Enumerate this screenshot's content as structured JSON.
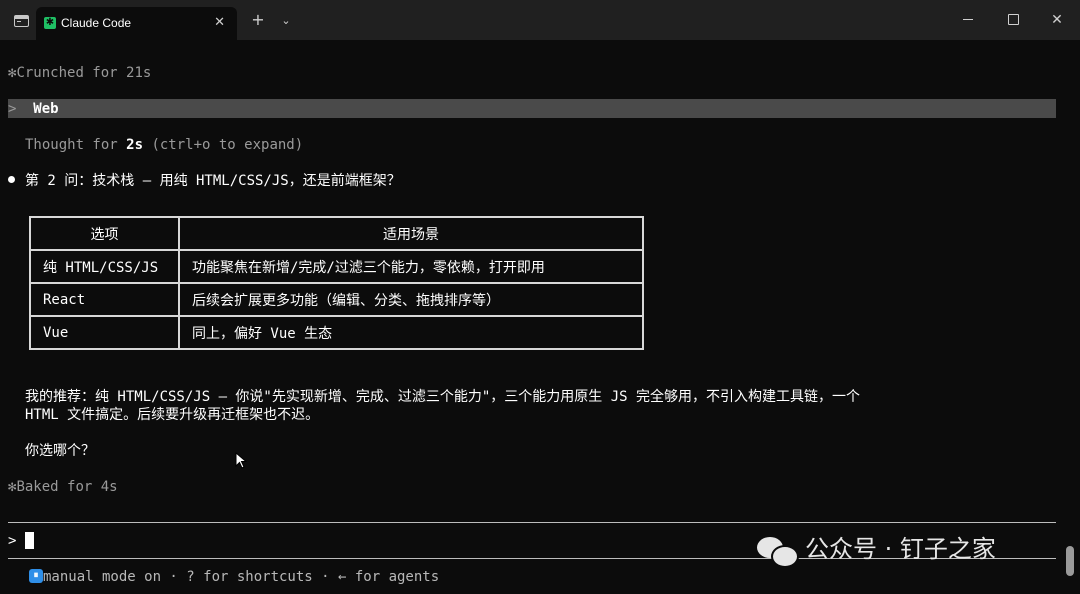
{
  "window": {
    "tab_title": "Claude Code",
    "tab_icon": "claude-spark-icon",
    "tab_close_glyph": "✕",
    "new_tab_glyph": "+",
    "dropdown_glyph": "⌄",
    "close_glyph": "✕"
  },
  "terminal": {
    "status1_glyph": "✻",
    "status1_text": "Crunched for 21s",
    "selected_prefix": ">",
    "selected_line": "Web",
    "thought_pre": "Thought for ",
    "thought_bold": "2s",
    "thought_post": " (ctrl+o to expand)",
    "question": "第 2 问：技术栈 — 用纯 HTML/CSS/JS，还是前端框架？",
    "table": {
      "headers": [
        "选项",
        "适用场景"
      ],
      "rows": [
        [
          "纯 HTML/CSS/JS",
          "功能聚焦在新增/完成/过滤三个能力，零依赖，打开即用"
        ],
        [
          "React",
          "后续会扩展更多功能（编辑、分类、拖拽排序等）"
        ],
        [
          "Vue",
          "同上，偏好 Vue 生态"
        ]
      ]
    },
    "recommendation_line1": "我的推荐：纯 HTML/CSS/JS — 你说\"先实现新增、完成、过滤三个能力\"，三个能力用原生 JS 完全够用，不引入构建工具链，一个",
    "recommendation_line2": "HTML 文件搞定。后续要升级再迁框架也不迟。",
    "ask": "你选哪个？",
    "status2_glyph": "✻",
    "status2_text": "Baked for 4s",
    "prompt_symbol": ">",
    "mode_icon_glyph": "⏸",
    "statusline": "manual mode on · ? for shortcuts · ← for agents"
  },
  "watermark": {
    "text": "公众号 · 钉子之家",
    "logo_icon": "wechat-logo-icon"
  },
  "colors": {
    "background": "#0c0c0c",
    "titlebar": "#202020",
    "selection": "#4a4a4a",
    "mode_badge": "#2f8fe8",
    "tab_icon": "#1fbf64"
  }
}
